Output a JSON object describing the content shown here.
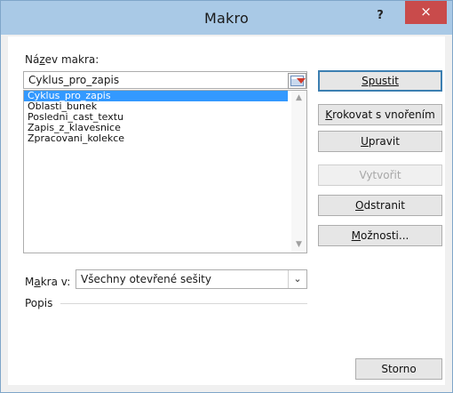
{
  "window": {
    "title": "Makro",
    "help_glyph": "?",
    "close_glyph": "×"
  },
  "name": {
    "label_pre": "Ná",
    "label_accel": "z",
    "label_post": "ev makra:",
    "value": "Cyklus_pro_zapis"
  },
  "macro_list": [
    {
      "label": "Cyklus_pro_zapis",
      "selected": true
    },
    {
      "label": "Oblasti_bunek",
      "selected": false
    },
    {
      "label": "Posledni_cast_textu",
      "selected": false
    },
    {
      "label": "Zapis_z_klavesnice",
      "selected": false
    },
    {
      "label": "Zpracovani_kolekce",
      "selected": false
    }
  ],
  "buttons": {
    "run": {
      "label": "Spustit"
    },
    "step_into": {
      "accel": "K",
      "rest": "rokovat s vnořením"
    },
    "edit": {
      "accel": "U",
      "rest": "pravit"
    },
    "create": {
      "label": "Vytvořit"
    },
    "delete": {
      "accel": "O",
      "rest": "dstranit"
    },
    "options": {
      "accel": "M",
      "rest": "ožnosti..."
    },
    "cancel": {
      "label": "Storno"
    }
  },
  "macros_in": {
    "label_pre": "M",
    "label_accel": "a",
    "label_post": "kra v:",
    "value": "Všechny otevřené sešity"
  },
  "description": {
    "label": "Popis"
  },
  "colors": {
    "titlebar": "#a9c9e6",
    "close": "#c94b4b",
    "selection": "#3399ff"
  },
  "icons": {
    "reference_button": "collapse-dialog-icon",
    "select_arrow": "chevron-down-icon"
  }
}
